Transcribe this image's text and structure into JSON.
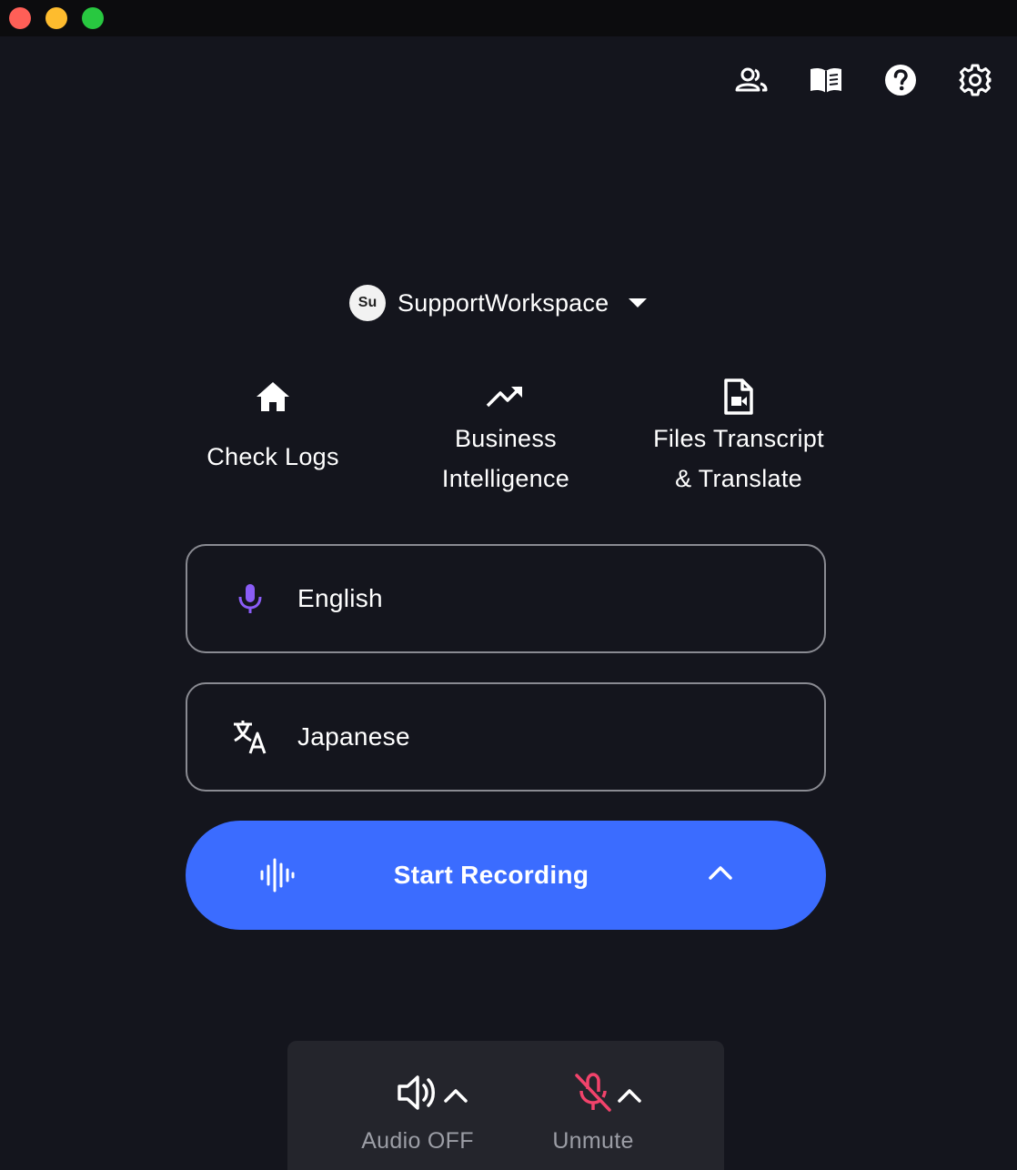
{
  "window": {
    "traffic_lights": [
      "close",
      "minimize",
      "maximize"
    ]
  },
  "toolbar": {
    "icons": [
      "people-icon",
      "book-icon",
      "help-icon",
      "gear-icon"
    ]
  },
  "workspace": {
    "avatar_initials": "Su",
    "name": "SupportWorkspace"
  },
  "nav": [
    {
      "icon": "home-icon",
      "label": "Check Logs"
    },
    {
      "icon": "trending-up-icon",
      "label": "Business\nIntelligence"
    },
    {
      "icon": "video-file-icon",
      "label": "Files Transcript\n& Translate"
    }
  ],
  "languages": {
    "source": {
      "icon": "microphone-icon",
      "label": "English",
      "icon_color": "#8a5cf6"
    },
    "target": {
      "icon": "translate-icon",
      "label": "Japanese"
    }
  },
  "record": {
    "label": "Start Recording",
    "color": "#3b6cff"
  },
  "controls": {
    "audio": {
      "icon": "speaker-icon",
      "label": "Audio OFF"
    },
    "mic": {
      "icon": "mic-off-icon",
      "label": "Unmute",
      "icon_color": "#f2436b"
    }
  }
}
